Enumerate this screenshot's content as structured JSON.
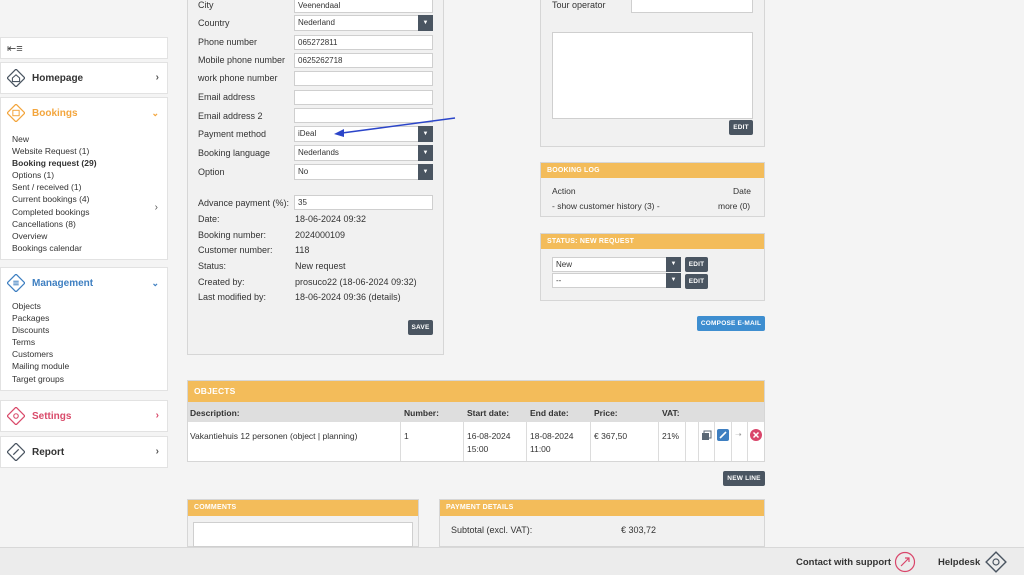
{
  "sidebar": {
    "collapse_icon": "collapse-menu-icon",
    "homepage": {
      "label": "Homepage",
      "icon": "house-icon",
      "color": "#4a5561"
    },
    "bookings": {
      "label": "Bookings",
      "icon": "calendar-icon",
      "color": "#f3a53c",
      "items": [
        "New",
        "Website Request (1)",
        "Booking request (29)",
        "Options (1)",
        "Sent / received (1)",
        "Current bookings (4)",
        "Completed bookings",
        "Cancellations (8)",
        "Overview",
        "Bookings calendar"
      ]
    },
    "management": {
      "label": "Management",
      "icon": "list-icon",
      "color": "#3e7fc1",
      "items": [
        "Objects",
        "Packages",
        "Discounts",
        "Terms",
        "Customers",
        "Mailing module",
        "Target groups"
      ]
    },
    "settings": {
      "label": "Settings",
      "icon": "gear-icon",
      "color": "#d94a6a"
    },
    "report": {
      "label": "Report",
      "icon": "pencil-icon",
      "color": "#4a5561"
    }
  },
  "customer_form": {
    "city": {
      "label": "City",
      "value": "Veenendaal"
    },
    "country": {
      "label": "Country",
      "value": "Nederland"
    },
    "phone": {
      "label": "Phone number",
      "value": "065272811"
    },
    "mobile": {
      "label": "Mobile phone number",
      "value": "0625262718"
    },
    "work_phone": {
      "label": "work phone number",
      "value": ""
    },
    "email": {
      "label": "Email address",
      "value": ""
    },
    "email2": {
      "label": "Email address 2",
      "value": ""
    },
    "payment_method": {
      "label": "Payment method",
      "value": "iDeal"
    },
    "booking_language": {
      "label": "Booking language",
      "value": "Nederlands"
    },
    "option": {
      "label": "Option",
      "value": "No"
    },
    "advance_payment": {
      "label": "Advance payment (%):",
      "value": "35"
    },
    "date": {
      "label": "Date:",
      "value": "18-06-2024 09:32"
    },
    "booking_number": {
      "label": "Booking number:",
      "value": "2024000109"
    },
    "customer_number": {
      "label": "Customer number:",
      "value": "118"
    },
    "status": {
      "label": "Status:",
      "value": "New request"
    },
    "created_by": {
      "label": "Created by:",
      "value": "prosuco22 (18-06-2024 09:32)"
    },
    "last_modified": {
      "label": "Last modified by:",
      "value": "18-06-2024 09:36 (details)"
    },
    "save_label": "SAVE"
  },
  "tour_panel": {
    "tour_operator_label": "Tour operator",
    "tour_operator_value": "",
    "notes_value": "",
    "edit_label": "EDIT"
  },
  "booking_log": {
    "title": "BOOKING LOG",
    "col_action": "Action",
    "col_date": "Date",
    "history_link": "- show customer history (3) -",
    "more_link": "more (0)"
  },
  "status_panel": {
    "title": "STATUS: NEW REQUEST",
    "status_select": "New",
    "sub_select": "--",
    "edit_label": "EDIT"
  },
  "compose_email_label": "COMPOSE E-MAIL",
  "objects": {
    "title": "OBJECTS",
    "headers": [
      "Description:",
      "Number:",
      "Start date:",
      "End date:",
      "Price:",
      "VAT:"
    ],
    "row": {
      "description": "Vakantiehuis 12 personen (object | planning)",
      "number": "1",
      "start_date": "16-08-2024",
      "start_time": "15:00",
      "end_date": "18-08-2024",
      "end_time": "11:00",
      "price": "€ 367,50",
      "vat": "21%"
    },
    "new_line_label": "NEW LINE"
  },
  "comments": {
    "title": "COMMENTS",
    "value": ""
  },
  "payment_details": {
    "title": "PAYMENT DETAILS",
    "subtotal_label": "Subtotal (excl. VAT):",
    "subtotal_value": "€ 303,72"
  },
  "footer": {
    "support_label": "Contact with support",
    "support_icon": "rocket-icon",
    "helpdesk_label": "Helpdesk",
    "helpdesk_icon": "lifebuoy-icon"
  },
  "colors": {
    "accent_orange": "#f3bc5a",
    "dark_button": "#4a5561",
    "blue_button": "#3e8ed0",
    "annotation_arrow": "#2b45c9"
  }
}
